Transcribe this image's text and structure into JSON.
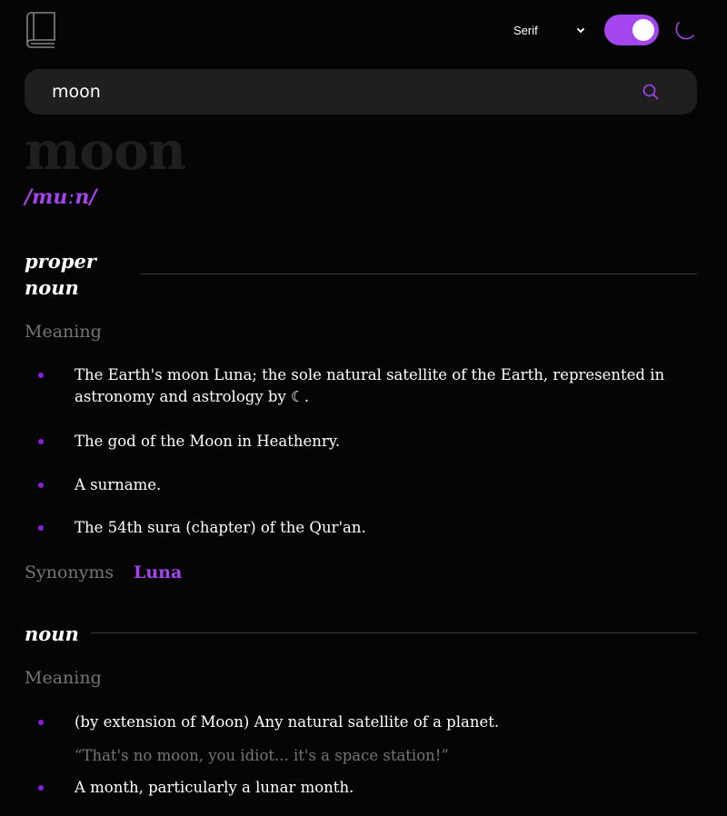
{
  "header": {
    "font_select": {
      "value": "Serif"
    },
    "theme_toggle": {
      "state": "on"
    }
  },
  "search": {
    "value": "moon"
  },
  "entry": {
    "word": "moon",
    "phonetic": "/muːn/"
  },
  "meanings": [
    {
      "part_of_speech_line1": "proper",
      "part_of_speech_line2": "noun",
      "label": "Meaning",
      "definitions": [
        {
          "text": "The Earth's moon Luna; the sole natural satellite of the Earth, represented in astronomy and astrology by ☾."
        },
        {
          "text": "The god of the Moon in Heathenry."
        },
        {
          "text": "A surname."
        },
        {
          "text": "The 54th sura (chapter) of the Qur'an."
        }
      ],
      "synonyms_label": "Synonyms",
      "synonyms": [
        "Luna"
      ]
    },
    {
      "part_of_speech": "noun",
      "label": "Meaning",
      "definitions": [
        {
          "text": "(by extension of Moon) Any natural satellite of a planet.",
          "example": "“That's no moon, you idiot... it's a space station!”"
        },
        {
          "text": "A month, particularly a lunar month."
        }
      ]
    }
  ],
  "colors": {
    "accent": "#A445ED",
    "background": "#050505",
    "muted": "#757575",
    "search_bg": "#1F1F1F"
  },
  "icons": [
    "book-icon",
    "chevron-down-icon",
    "moon-icon",
    "search-icon"
  ]
}
